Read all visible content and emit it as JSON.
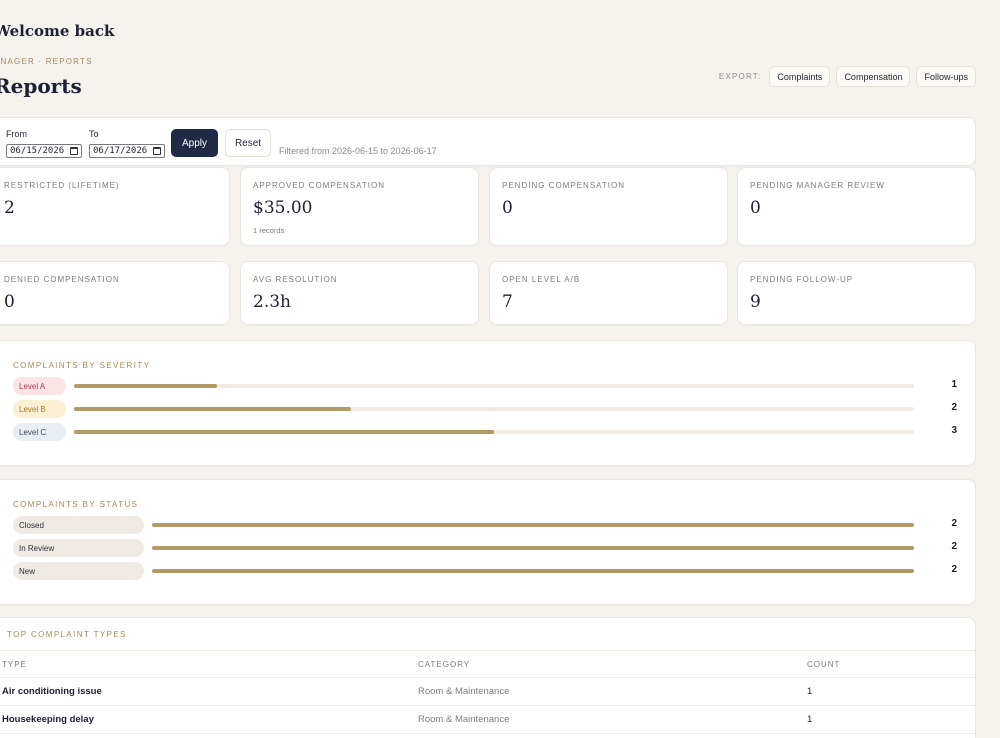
{
  "header": {
    "welcome": "Welcome back",
    "breadcrumb": "ANAGER · REPORTS",
    "title": "Reports"
  },
  "export": {
    "label": "EXPORT:",
    "buttons": [
      "Complaints",
      "Compensation",
      "Follow-ups"
    ]
  },
  "filters": {
    "from_label": "From",
    "to_label": "To",
    "from_value": "06/15/2026",
    "to_value": "06/17/2026",
    "apply_label": "Apply",
    "reset_label": "Reset",
    "note": "Filtered from 2026-06-15 to 2026-06-17"
  },
  "stats": [
    {
      "label": "RESTRICTED (LIFETIME)",
      "value": "2",
      "sub": ""
    },
    {
      "label": "APPROVED COMPENSATION",
      "value": "$35.00",
      "sub": "1 records"
    },
    {
      "label": "PENDING COMPENSATION",
      "value": "0",
      "sub": ""
    },
    {
      "label": "PENDING MANAGER REVIEW",
      "value": "0",
      "sub": ""
    },
    {
      "label": "DENIED COMPENSATION",
      "value": "0",
      "sub": ""
    },
    {
      "label": "AVG RESOLUTION",
      "value": "2.3h",
      "sub": ""
    },
    {
      "label": "OPEN LEVEL A/B",
      "value": "7",
      "sub": ""
    },
    {
      "label": "PENDING FOLLOW-UP",
      "value": "9",
      "sub": ""
    }
  ],
  "severity": {
    "title": "COMPLAINTS BY SEVERITY",
    "rows": [
      {
        "label": "Level A",
        "count": "1",
        "fraction": 0.17,
        "pill_bg": "#fbe3e6",
        "pill_color": "#b23a4a"
      },
      {
        "label": "Level B",
        "count": "2",
        "fraction": 0.33,
        "pill_bg": "#fbf0d4",
        "pill_color": "#a67c1e"
      },
      {
        "label": "Level C",
        "count": "3",
        "fraction": 0.5,
        "pill_bg": "#e9eef4",
        "pill_color": "#3e4a5e"
      }
    ]
  },
  "status": {
    "title": "COMPLAINTS BY STATUS",
    "rows": [
      {
        "label": "Closed",
        "count": "2",
        "fraction": 1.0
      },
      {
        "label": "In Review",
        "count": "2",
        "fraction": 1.0
      },
      {
        "label": "New",
        "count": "2",
        "fraction": 1.0
      }
    ]
  },
  "top_types": {
    "title": "TOP COMPLAINT TYPES",
    "columns": [
      "TYPE",
      "CATEGORY",
      "COUNT"
    ],
    "rows": [
      {
        "type": "Air conditioning issue",
        "category": "Room & Maintenance",
        "count": "1"
      },
      {
        "type": "Housekeeping delay",
        "category": "Room & Maintenance",
        "count": "1"
      }
    ]
  },
  "colors": {
    "accent_gold": "#b19a66",
    "navy": "#212a44",
    "background": "#f6f3ee"
  }
}
